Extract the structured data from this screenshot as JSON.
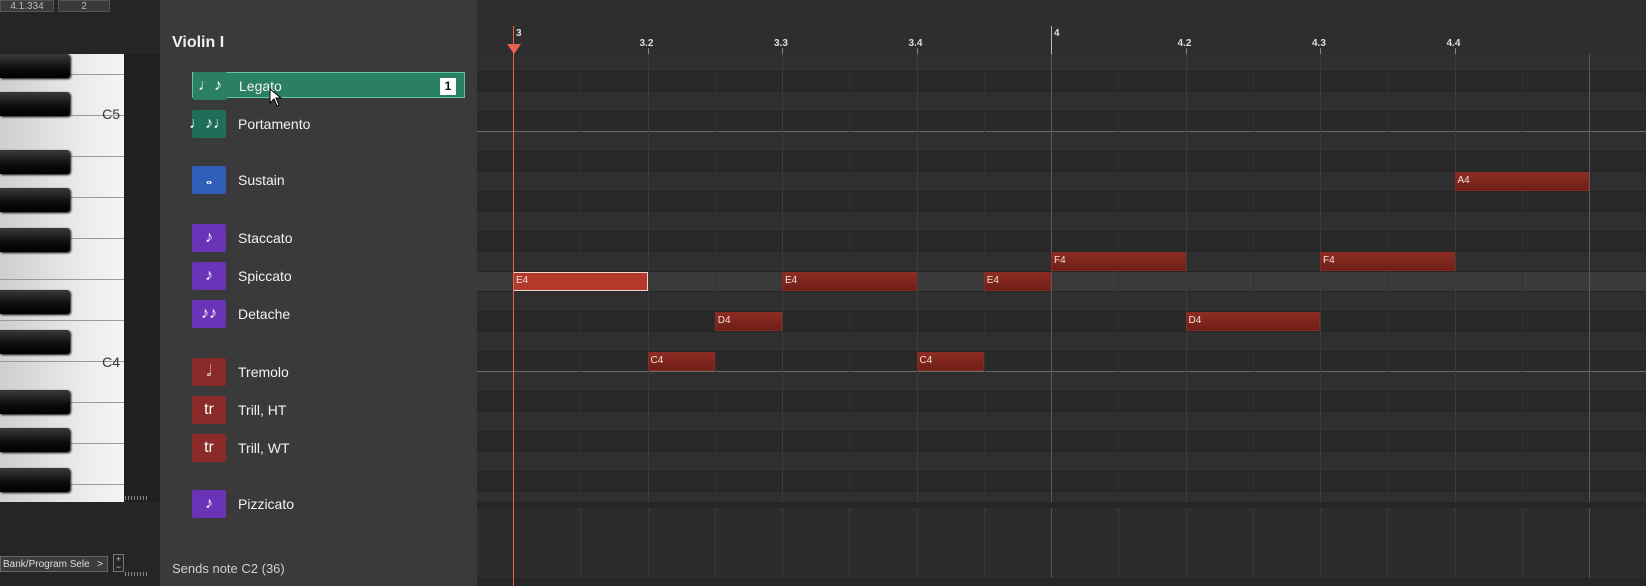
{
  "top": {
    "position_readout": "4.1.334",
    "value_readout": "2"
  },
  "keyboard": {
    "labels": [
      "C5",
      "C4"
    ]
  },
  "bank_button": {
    "label": "Bank/Program Sele",
    "arrow": ">"
  },
  "panel": {
    "title": "Violin I",
    "status": "Sends note C2 (36)",
    "articulations": [
      {
        "label": "Legato",
        "icon": "legato-icon",
        "color": "#2a8060",
        "selected": true,
        "badge": "1",
        "glyph": "♩♪"
      },
      {
        "label": "Portamento",
        "icon": "portamento-icon",
        "color": "#1f6e58",
        "glyph": "♩♪♩"
      },
      {
        "label": "Sustain",
        "icon": "sustain-icon",
        "color": "#2f5fb8",
        "glyph": "𝅝"
      },
      {
        "label": "Staccato",
        "icon": "staccato-icon",
        "color": "#6a34b8",
        "glyph": "♪"
      },
      {
        "label": "Spiccato",
        "icon": "spiccato-icon",
        "color": "#6a34b8",
        "glyph": "♪"
      },
      {
        "label": "Detache",
        "icon": "detache-icon",
        "color": "#6a34b8",
        "glyph": "♪♪"
      },
      {
        "label": "Tremolo",
        "icon": "tremolo-icon",
        "color": "#8a2a2a",
        "glyph": "𝅗𝅥"
      },
      {
        "label": "Trill, HT",
        "icon": "trill-ht-icon",
        "color": "#8a2a2a",
        "glyph": "tr"
      },
      {
        "label": "Trill, WT",
        "icon": "trill-wt-icon",
        "color": "#8a2a2a",
        "glyph": "tr"
      },
      {
        "label": "Pizzicato",
        "icon": "pizzicato-icon",
        "color": "#6a34b8",
        "glyph": "♪"
      }
    ]
  },
  "ruler": {
    "labels": [
      "3",
      "3.2",
      "3.3",
      "3.4",
      "4",
      "4.2",
      "4.3",
      "4.4"
    ]
  },
  "notes": [
    {
      "pitch": "E4",
      "start": 0,
      "len": 1,
      "selected": true
    },
    {
      "pitch": "C4",
      "start": 1,
      "len": 0.5
    },
    {
      "pitch": "D4",
      "start": 1.5,
      "len": 0.5
    },
    {
      "pitch": "E4",
      "start": 2,
      "len": 1
    },
    {
      "pitch": "C4",
      "start": 3,
      "len": 0.5
    },
    {
      "pitch": "E4",
      "start": 3.5,
      "len": 0.5
    },
    {
      "pitch": "F4",
      "start": 4,
      "len": 1
    },
    {
      "pitch": "D4",
      "start": 5,
      "len": 1
    },
    {
      "pitch": "F4",
      "start": 6,
      "len": 1
    },
    {
      "pitch": "A4",
      "start": 7,
      "len": 1
    }
  ]
}
